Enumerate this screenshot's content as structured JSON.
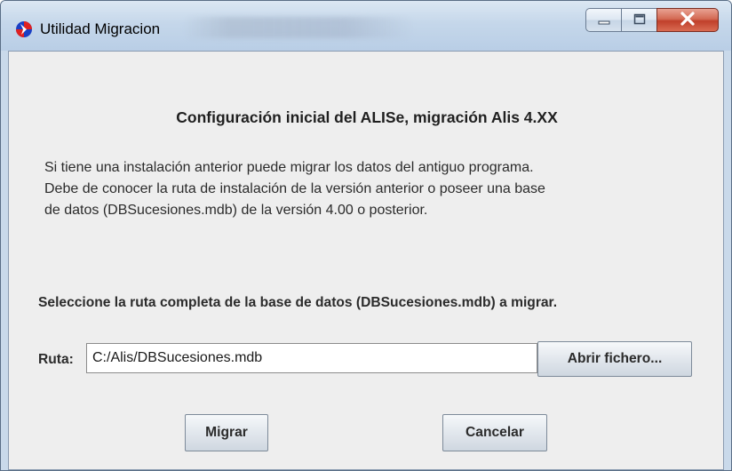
{
  "window": {
    "title": "Utilidad Migracion",
    "icon": "app-logo-icon",
    "controls": {
      "minimize_icon": "minimize-icon",
      "maximize_icon": "maximize-icon",
      "close_icon": "close-icon"
    }
  },
  "content": {
    "heading": "Configuración inicial del ALISe, migración Alis 4.XX",
    "paragraph_lines": [
      "Si tiene una instalación anterior puede migrar los datos del antiguo programa.",
      "Debe de conocer la ruta de instalación de la versión anterior o poseer una base",
      "de datos (DBSucesiones.mdb) de la versión 4.00 o posterior."
    ],
    "instruction": "Seleccione la ruta completa de la base de datos (DBSucesiones.mdb) a migrar.",
    "ruta_label": "Ruta:",
    "ruta_value": "C:/Alis/DBSucesiones.mdb",
    "open_file_label": "Abrir fichero...",
    "migrate_label": "Migrar",
    "cancel_label": "Cancelar"
  },
  "colors": {
    "title_bar": "#c9d9ea",
    "panel": "#eeeeee",
    "close_button": "#c9462f"
  }
}
